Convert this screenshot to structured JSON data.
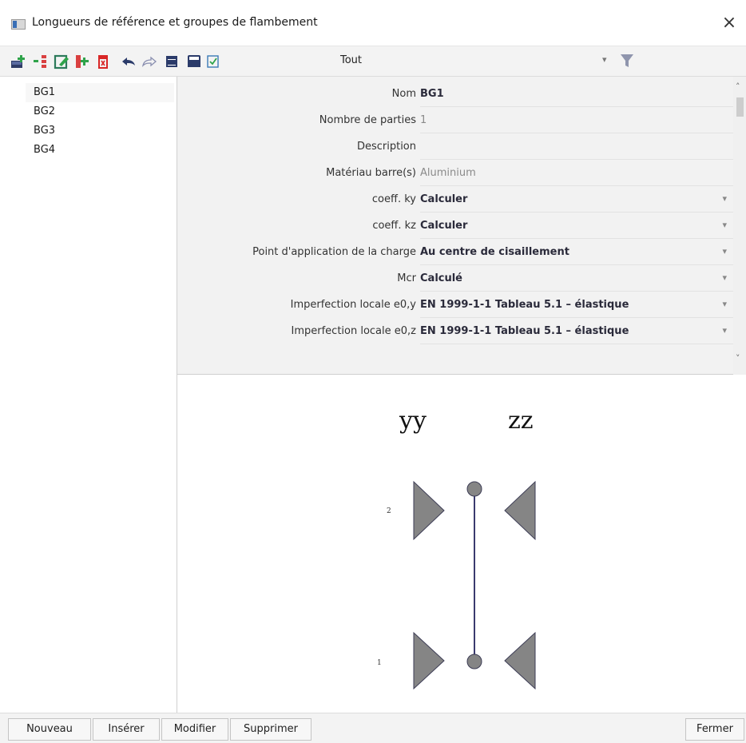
{
  "window": {
    "title": "Longueurs de référence et groupes de flambement",
    "close_glyph": "×"
  },
  "toolbar": {
    "icons": [
      "new-record-icon",
      "insert-icon",
      "edit-icon",
      "copy-icon",
      "delete-icon",
      "undo-icon",
      "redo-icon",
      "table-icon",
      "save-icon",
      "checklist-icon",
      "funnel-icon"
    ],
    "filter_value": "Tout",
    "filter_chevron": "▾"
  },
  "groups": [
    "BG1",
    "BG2",
    "BG3",
    "BG4"
  ],
  "properties": {
    "nom": {
      "label": "Nom",
      "value": "BG1"
    },
    "parties": {
      "label": "Nombre de parties",
      "value": "1"
    },
    "description": {
      "label": "Description",
      "value": ""
    },
    "materiau": {
      "label": "Matériau barre(s)",
      "value": "Aluminium"
    },
    "ky": {
      "label": "coeff. ky",
      "value": "Calculer"
    },
    "kz": {
      "label": "coeff. kz",
      "value": "Calculer"
    },
    "charge": {
      "label": "Point d'application de la charge",
      "value": "Au centre de cisaillement"
    },
    "mcr": {
      "label": "Mcr",
      "value": "Calculé"
    },
    "e0y": {
      "label": "Imperfection locale e0,y",
      "value": "EN 1999-1-1 Tableau 5.1 – élastique"
    },
    "e0z": {
      "label": "Imperfection locale e0,z",
      "value": "EN 1999-1-1 Tableau 5.1 – élastique"
    },
    "dropdown_chevron": "▾"
  },
  "scrollbar": {
    "up": "˄",
    "down": "˅"
  },
  "diagram": {
    "label_yy": "yy",
    "label_zz": "zz",
    "node_top": "2",
    "node_bottom": "1",
    "colors": {
      "shape_fill": "#858585",
      "shape_stroke": "#3c3c55",
      "member": "#3a3a6e"
    }
  },
  "buttons": {
    "nouveau": "Nouveau",
    "inserer": "Insérer",
    "modifier": "Modifier",
    "supprimer": "Supprimer",
    "fermer": "Fermer"
  }
}
